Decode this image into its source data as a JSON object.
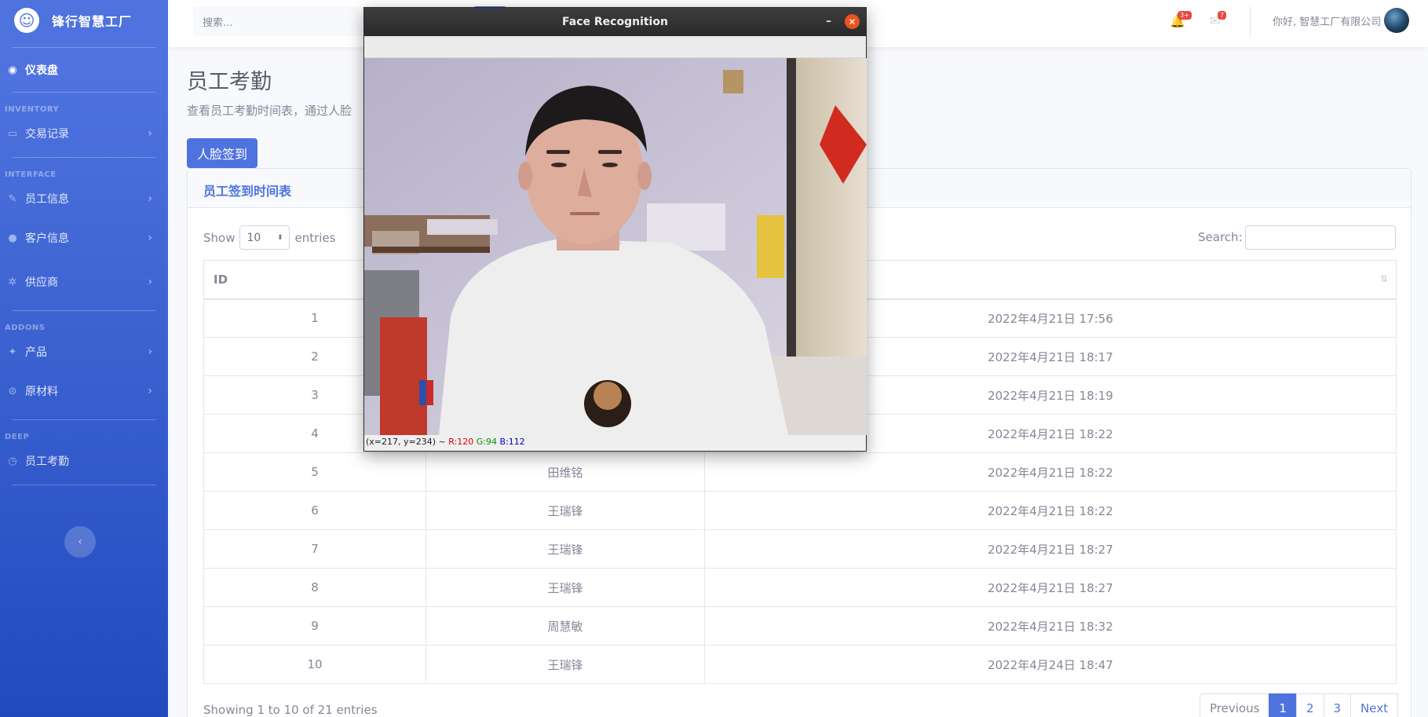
{
  "sidebar": {
    "brand": "锋行智慧工厂",
    "brand_logo": "smile-icon",
    "dashboard": "仪表盘",
    "headings": {
      "inventory": "INVENTORY",
      "interface": "INTERFACE",
      "addons": "ADDONS",
      "deep": "DEEP"
    },
    "items": {
      "transactions": "交易记录",
      "employees": "员工信息",
      "customers": "客户信息",
      "suppliers": "供应商",
      "products": "产品",
      "materials": "原材料",
      "attendance": "员工考勤"
    }
  },
  "topbar": {
    "search_placeholder": "搜索...",
    "alerts_badge": "3+",
    "messages_badge": "7",
    "user_greeting": "你好, 智慧工厂有限公司"
  },
  "page": {
    "title": "员工考勤",
    "description": "查看员工考勤时间表，通过人脸",
    "face_button": "人脸签到"
  },
  "card": {
    "title": "员工签到时间表",
    "show_label": "Show",
    "entries_value": "10",
    "entries_label": "entries",
    "search_label": "Search:",
    "column_id": "ID",
    "rows": [
      {
        "id": "1",
        "name": "",
        "time": "2022年4月21日 17:56"
      },
      {
        "id": "2",
        "name": "",
        "time": "2022年4月21日 18:17"
      },
      {
        "id": "3",
        "name": "",
        "time": "2022年4月21日 18:19"
      },
      {
        "id": "4",
        "name": "",
        "time": "2022年4月21日 18:22"
      },
      {
        "id": "5",
        "name": "田维铭",
        "time": "2022年4月21日 18:22"
      },
      {
        "id": "6",
        "name": "王瑞锋",
        "time": "2022年4月21日 18:22"
      },
      {
        "id": "7",
        "name": "王瑞锋",
        "time": "2022年4月21日 18:27"
      },
      {
        "id": "8",
        "name": "王瑞锋",
        "time": "2022年4月21日 18:27"
      },
      {
        "id": "9",
        "name": "周慧敏",
        "time": "2022年4月21日 18:32"
      },
      {
        "id": "10",
        "name": "王瑞锋",
        "time": "2022年4月24日 18:47"
      }
    ],
    "info": "Showing 1 to 10 of 21 entries",
    "pager": {
      "previous": "Previous",
      "p1": "1",
      "p2": "2",
      "p3": "3",
      "next": "Next"
    }
  },
  "face_window": {
    "title": "Face Recognition",
    "status_prefix": "(x=217, y=234) ~ ",
    "r": "R:120",
    "g": "G:94",
    "b": "B:112"
  },
  "colors": {
    "primary": "#4e73df",
    "danger": "#e74a3b",
    "window_close": "#e95420"
  }
}
